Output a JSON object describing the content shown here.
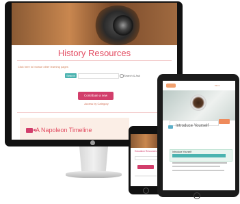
{
  "imac": {
    "page_title": "History Resources",
    "info_text": "Click here to browse other learning pages",
    "search_button": "Search",
    "radio_label": "Search & Ask",
    "contribute_button": "Contribute a new resource",
    "access_link": "Access by Category",
    "timeline_title": "A Napoleon Timeline"
  },
  "ipad": {
    "menu_label": "Menu",
    "heading": "Introduce Yourself",
    "note_title": "Introduce Yourself"
  },
  "iphone": {
    "title": "Education Resources"
  },
  "colors": {
    "accent_pink": "#e2495f",
    "button_magenta": "#d23e6b",
    "teal": "#4bb3b0",
    "orange": "#ef8b5c"
  }
}
